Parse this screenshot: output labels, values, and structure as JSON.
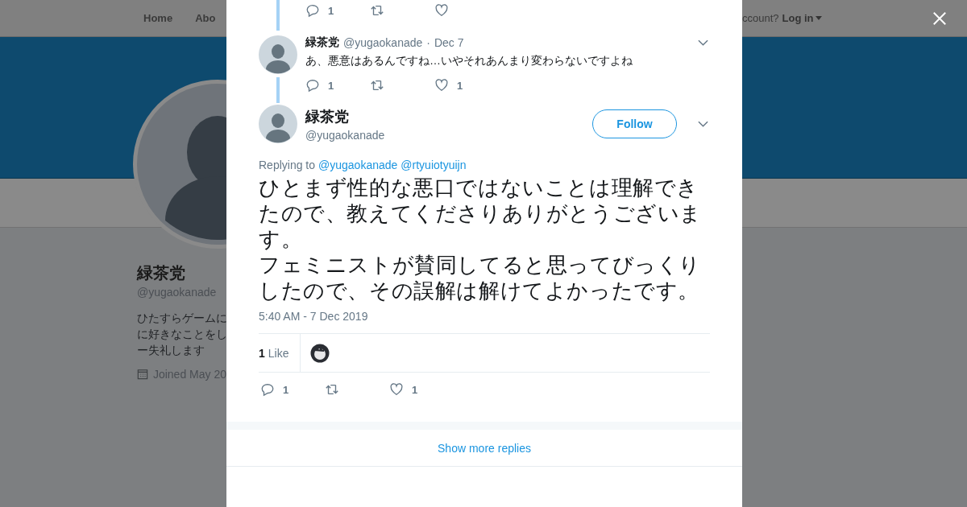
{
  "background_page": {
    "nav": [
      {
        "label": "Home"
      },
      {
        "label": "Abo"
      }
    ],
    "account_prompt": "ccount?",
    "login_link": "Log in",
    "profile": {
      "name": "緑茶党",
      "handle": "@yugaokanade",
      "bio": [
        "ひたすらゲームに",
        "に好きなことをし",
        "ー失礼します"
      ],
      "joined": "Joined May 20"
    }
  },
  "conversation": {
    "previous_tweet_actions": [
      {
        "kind": "reply",
        "count": "1"
      },
      {
        "kind": "retweet"
      },
      {
        "kind": "like"
      }
    ],
    "reply_tweet": {
      "name": "緑茶党",
      "handle": "@yugaokanade",
      "separator": "·",
      "date": "Dec 7",
      "text": "あ、悪意はあるんですね…いやそれあんまり変わらないですよね",
      "actions": [
        {
          "kind": "reply",
          "count": "1"
        },
        {
          "kind": "retweet"
        },
        {
          "kind": "like",
          "count": "1"
        }
      ]
    },
    "main_tweet": {
      "name": "緑茶党",
      "handle": "@yugaokanade",
      "follow_label": "Follow",
      "replying_label": "Replying to",
      "replying_to": [
        "@yugaokanade",
        "@rtyuiotyuijn"
      ],
      "text": [
        "ひとまず性的な悪口ではないことは理解できたので、教えてくださりありがとうございます。",
        "フェミニストが賛同してると思ってびっくりしたので、その誤解は解けてよかったです。"
      ],
      "timestamp": "5:40 AM - 7 Dec 2019",
      "like_count": "1",
      "like_label": "Like",
      "actions": [
        {
          "kind": "reply",
          "count": "1"
        },
        {
          "kind": "retweet"
        },
        {
          "kind": "like",
          "count": "1"
        }
      ]
    },
    "show_more": "Show more replies"
  }
}
